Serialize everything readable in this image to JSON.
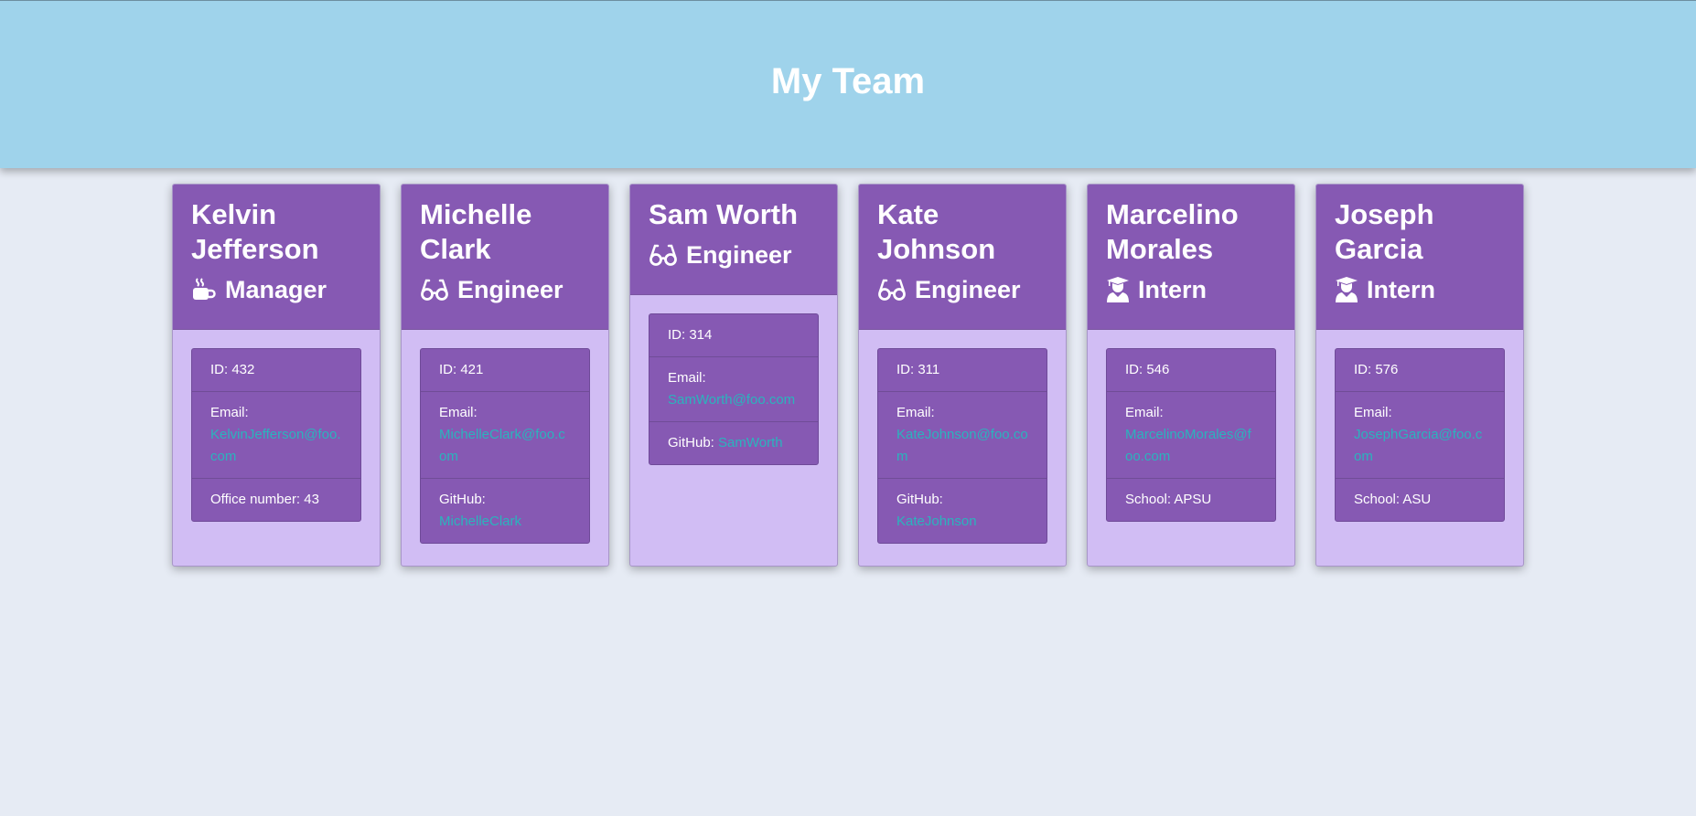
{
  "header": {
    "title": "My Team"
  },
  "employees": [
    {
      "name": "Kelvin Jefferson",
      "role": "Manager",
      "icon": "coffee-icon",
      "id_label": "ID: 432",
      "email_label": "Email:",
      "email": "KelvinJefferson@foo.com",
      "extra_label": "Office number: 43",
      "extra_link": ""
    },
    {
      "name": "Michelle Clark",
      "role": "Engineer",
      "icon": "glasses-icon",
      "id_label": "ID: 421",
      "email_label": "Email:",
      "email": "MichelleClark@foo.com",
      "extra_label": "GitHub:",
      "extra_link": "MichelleClark"
    },
    {
      "name": "Sam Worth",
      "role": "Engineer",
      "icon": "glasses-icon",
      "id_label": "ID: 314",
      "email_label": "Email:",
      "email": "SamWorth@foo.com",
      "extra_label": "GitHub:",
      "extra_link": "SamWorth"
    },
    {
      "name": "Kate Johnson",
      "role": "Engineer",
      "icon": "glasses-icon",
      "id_label": "ID: 311",
      "email_label": "Email:",
      "email": "KateJohnson@foo.com",
      "extra_label": "GitHub:",
      "extra_link": "KateJohnson"
    },
    {
      "name": "Marcelino Morales",
      "role": "Intern",
      "icon": "graduate-icon",
      "id_label": "ID: 546",
      "email_label": "Email:",
      "email": "MarcelinoMorales@foo.com",
      "extra_label": "School: APSU",
      "extra_link": ""
    },
    {
      "name": "Joseph Garcia",
      "role": "Intern",
      "icon": "graduate-icon",
      "id_label": "ID: 576",
      "email_label": "Email:",
      "email": "JosephGarcia@foo.com",
      "extra_label": "School: ASU",
      "extra_link": ""
    }
  ],
  "colors": {
    "header_bg": "#9fd3eb",
    "card_head": "#8659b3",
    "card_body": "#d1bdf4",
    "link": "#2ab4bd",
    "page_bg": "#e6ebf4"
  }
}
